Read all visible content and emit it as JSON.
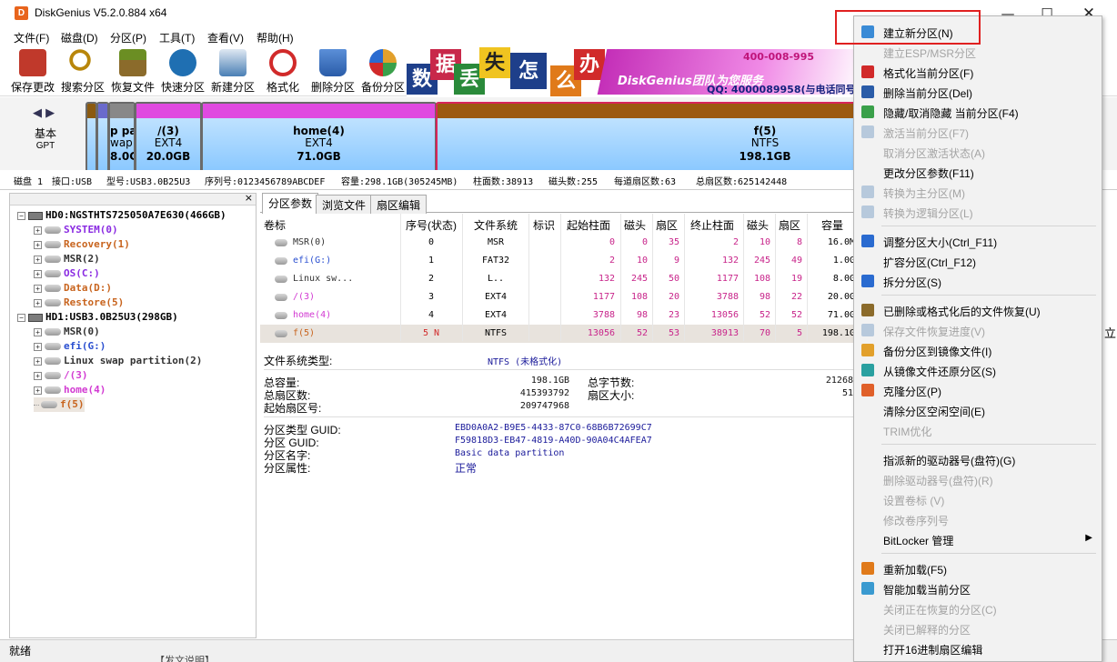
{
  "window": {
    "title": "DiskGenius V5.2.0.884 x64",
    "controls": {
      "minimize": "—",
      "maximize": "☐",
      "close": "✕"
    }
  },
  "menu": [
    "文件(F)",
    "磁盘(D)",
    "分区(P)",
    "工具(T)",
    "查看(V)",
    "帮助(H)"
  ],
  "toolbar": [
    {
      "label": "保存更改",
      "icon": "save-icon",
      "color": "#c0392b"
    },
    {
      "label": "搜索分区",
      "icon": "magnifier-icon",
      "color": "#b8860b"
    },
    {
      "label": "恢复文件",
      "icon": "recover-box-icon",
      "color": "#6b8e23"
    },
    {
      "label": "快速分区",
      "icon": "fast-partition-icon",
      "color": "#1f6fb2"
    },
    {
      "label": "新建分区",
      "icon": "new-partition-icon",
      "color": "#4a7fb5"
    },
    {
      "label": "格式化",
      "icon": "format-icon",
      "color": "#d12a2a"
    },
    {
      "label": "删除分区",
      "icon": "trash-icon",
      "color": "#2a5ca8"
    },
    {
      "label": "备份分区",
      "icon": "backup-disc-icon",
      "color": "#e2a02b"
    }
  ],
  "banner": {
    "chars": [
      "数",
      "据",
      "丢",
      "失",
      "怎",
      "么",
      "办"
    ],
    "team_text": "DiskGenius团队为您服务",
    "phone": "400-008-995",
    "qq": "QQ: 4000089958(与电话同号"
  },
  "diskmap": {
    "nav": "◀ ▶",
    "disk_type": "基本",
    "disk_style": "GPT",
    "partitions": [
      {
        "name": "",
        "fs": "",
        "size": ""
      },
      {
        "name": "",
        "fs": "",
        "size": ""
      },
      {
        "name": "p pa",
        "fs": "wap p",
        "size": "8.0GI"
      },
      {
        "name": "/(3)",
        "fs": "EXT4",
        "size": "20.0GB"
      },
      {
        "name": "home(4)",
        "fs": "EXT4",
        "size": "71.0GB"
      },
      {
        "name": "f(5)",
        "fs": "NTFS",
        "size": "198.1GB"
      }
    ]
  },
  "disk_info": {
    "disk": "磁盘 1",
    "interface": "接口:USB",
    "model": "型号:USB3.0B25U3",
    "serial": "序列号:0123456789ABCDEF",
    "capacity": "容量:298.1GB(305245MB)",
    "cylinders": "柱面数:38913",
    "heads": "磁头数:255",
    "sectors_per_track": "每道扇区数:63",
    "total_sectors": "总扇区数:625142448"
  },
  "tree": [
    {
      "text": "HD0:NGSTHTS725050A7E630(466GB)",
      "level": 0,
      "kind": "disk",
      "color": "#000000",
      "exp": "−"
    },
    {
      "text": "SYSTEM(0)",
      "level": 1,
      "kind": "part",
      "color": "#8a2be2",
      "exp": "+"
    },
    {
      "text": "Recovery(1)",
      "level": 1,
      "kind": "part",
      "color": "#c8641e",
      "exp": "+"
    },
    {
      "text": "MSR(2)",
      "level": 1,
      "kind": "part",
      "color": "#333333",
      "exp": "+"
    },
    {
      "text": "OS(C:)",
      "level": 1,
      "kind": "part",
      "color": "#8a2be2",
      "exp": "+"
    },
    {
      "text": "Data(D:)",
      "level": 1,
      "kind": "part",
      "color": "#c8641e",
      "exp": "+"
    },
    {
      "text": "Restore(5)",
      "level": 1,
      "kind": "part",
      "color": "#c8641e",
      "exp": "+"
    },
    {
      "text": "HD1:USB3.0B25U3(298GB)",
      "level": 0,
      "kind": "disk",
      "color": "#000000",
      "exp": "−"
    },
    {
      "text": "MSR(0)",
      "level": 1,
      "kind": "part",
      "color": "#333333",
      "exp": "+"
    },
    {
      "text": "efi(G:)",
      "level": 1,
      "kind": "part",
      "color": "#2a4fd0",
      "exp": "+"
    },
    {
      "text": "Linux swap partition(2)",
      "level": 1,
      "kind": "part",
      "color": "#333333",
      "exp": "+"
    },
    {
      "text": "/(3)",
      "level": 1,
      "kind": "part",
      "color": "#d23ad2",
      "exp": "+"
    },
    {
      "text": "home(4)",
      "level": 1,
      "kind": "part",
      "color": "#d23ad2",
      "exp": "+"
    },
    {
      "text": "f(5)",
      "level": 1,
      "kind": "part",
      "color": "#c8641e",
      "exp": "",
      "selected": true
    }
  ],
  "tabs": [
    "分区参数",
    "浏览文件",
    "扇区编辑"
  ],
  "table": {
    "headers": [
      "卷标",
      "序号(状态)",
      "文件系统",
      "标识",
      "起始柱面",
      "磁头",
      "扇区",
      "终止柱面",
      "磁头",
      "扇区",
      "容量"
    ],
    "rows": [
      {
        "label": "MSR(0)",
        "idx": "0",
        "fs": "MSR",
        "flag": "",
        "sc": "0",
        "sh": "0",
        "ss": "35",
        "ec": "2",
        "eh": "10",
        "es": "8",
        "size": "16.0M",
        "color": "#333333"
      },
      {
        "label": "efi(G:)",
        "idx": "1",
        "fs": "FAT32",
        "flag": "",
        "sc": "2",
        "sh": "10",
        "ss": "9",
        "ec": "132",
        "eh": "245",
        "es": "49",
        "size": "1.0G",
        "color": "#2a4fd0"
      },
      {
        "label": "Linux sw...",
        "idx": "2",
        "fs": "L..",
        "flag": "",
        "sc": "132",
        "sh": "245",
        "ss": "50",
        "ec": "1177",
        "eh": "108",
        "es": "19",
        "size": "8.0G",
        "color": "#333333"
      },
      {
        "label": "/(3)",
        "idx": "3",
        "fs": "EXT4",
        "flag": "",
        "sc": "1177",
        "sh": "108",
        "ss": "20",
        "ec": "3788",
        "eh": "98",
        "es": "22",
        "size": "20.0G",
        "color": "#d23ad2"
      },
      {
        "label": "home(4)",
        "idx": "4",
        "fs": "EXT4",
        "flag": "",
        "sc": "3788",
        "sh": "98",
        "ss": "23",
        "ec": "13056",
        "eh": "52",
        "es": "52",
        "size": "71.0G",
        "color": "#d23ad2"
      },
      {
        "label": "f(5)",
        "idx": "5 N",
        "fs": "NTFS",
        "flag": "",
        "sc": "13056",
        "sh": "52",
        "ss": "53",
        "ec": "38913",
        "eh": "70",
        "es": "5",
        "size": "198.1G",
        "color": "#c8641e",
        "selected": true
      }
    ]
  },
  "details": {
    "fs_type_label": "文件系统类型:",
    "fs_type_value": "NTFS (未格式化)",
    "total_cap_label": "总容量:",
    "total_cap_value": "198.1GB",
    "total_bytes_label": "总字节数:",
    "total_bytes_value": "21268",
    "total_sectors_label": "总扇区数:",
    "total_sectors_value": "415393792",
    "sector_size_label": "扇区大小:",
    "sector_size_value": "51",
    "start_sector_label": "起始扇区号:",
    "start_sector_value": "209747968",
    "type_guid_label": "分区类型 GUID:",
    "type_guid_value": "EBD0A0A2-B9E5-4433-87C0-68B6B72699C7",
    "part_guid_label": "分区 GUID:",
    "part_guid_value": "F59818D3-EB47-4819-A40D-90A04C4AFEA7",
    "part_name_label": "分区名字:",
    "part_name_value": "Basic data partition",
    "part_attr_label": "分区属性:",
    "part_attr_value": "正常"
  },
  "context_menu": [
    {
      "label": "建立新分区(N)",
      "enabled": true,
      "icon": "new-partition-icon",
      "color": "#3b8bd6"
    },
    {
      "label": "建立ESP/MSR分区",
      "enabled": false,
      "icon": "",
      "color": ""
    },
    {
      "label": "格式化当前分区(F)",
      "enabled": true,
      "icon": "format-icon",
      "color": "#d12a2a"
    },
    {
      "label": "删除当前分区(Del)",
      "enabled": true,
      "icon": "trash-icon",
      "color": "#2a5ca8"
    },
    {
      "label": "隐藏/取消隐藏 当前分区(F4)",
      "enabled": true,
      "icon": "hide-icon",
      "color": "#3aa04a"
    },
    {
      "label": "激活当前分区(F7)",
      "enabled": false,
      "icon": "activate-icon",
      "color": "#4a7fb5"
    },
    {
      "label": "取消分区激活状态(A)",
      "enabled": false,
      "icon": "",
      "color": ""
    },
    {
      "label": "更改分区参数(F11)",
      "enabled": true,
      "icon": "",
      "color": ""
    },
    {
      "label": "转换为主分区(M)",
      "enabled": false,
      "icon": "convert-primary-icon",
      "color": "#4a7fb5"
    },
    {
      "label": "转换为逻辑分区(L)",
      "enabled": false,
      "icon": "convert-logical-icon",
      "color": "#4a7fb5"
    },
    {
      "sep": true
    },
    {
      "label": "调整分区大小(Ctrl_F11)",
      "enabled": true,
      "icon": "resize-icon",
      "color": "#2a6bd0"
    },
    {
      "label": "扩容分区(Ctrl_F12)",
      "enabled": true,
      "icon": "",
      "color": ""
    },
    {
      "label": "拆分分区(S)",
      "enabled": true,
      "icon": "split-icon",
      "color": "#2a6bd0"
    },
    {
      "sep": true
    },
    {
      "label": "已删除或格式化后的文件恢复(U)",
      "enabled": true,
      "icon": "recover-box-icon",
      "color": "#8b6b2b"
    },
    {
      "label": "保存文件恢复进度(V)",
      "enabled": false,
      "icon": "save-progress-icon",
      "color": "#4a7fb5"
    },
    {
      "label": "备份分区到镜像文件(I)",
      "enabled": true,
      "icon": "backup-disc-icon",
      "color": "#e2a02b"
    },
    {
      "label": "从镜像文件还原分区(S)",
      "enabled": true,
      "icon": "restore-icon",
      "color": "#2aa0a0"
    },
    {
      "label": "克隆分区(P)",
      "enabled": true,
      "icon": "clone-icon",
      "color": "#e0602a"
    },
    {
      "label": "清除分区空闲空间(E)",
      "enabled": true,
      "icon": "",
      "color": ""
    },
    {
      "label": "TRIM优化",
      "enabled": false,
      "icon": "",
      "color": ""
    },
    {
      "sep": true
    },
    {
      "label": "指派新的驱动器号(盘符)(G)",
      "enabled": true,
      "icon": "",
      "color": ""
    },
    {
      "label": "删除驱动器号(盘符)(R)",
      "enabled": false,
      "icon": "",
      "color": ""
    },
    {
      "label": "设置卷标 (V)",
      "enabled": false,
      "icon": "",
      "color": ""
    },
    {
      "label": "修改卷序列号",
      "enabled": false,
      "icon": "",
      "color": ""
    },
    {
      "label": "BitLocker 管理",
      "enabled": true,
      "icon": "",
      "color": "",
      "submenu": true
    },
    {
      "sep": true
    },
    {
      "label": "重新加载(F5)",
      "enabled": true,
      "icon": "reload-icon",
      "color": "#e07a1a"
    },
    {
      "label": "智能加载当前分区",
      "enabled": true,
      "icon": "smart-load-icon",
      "color": "#3a9ad0"
    },
    {
      "label": "关闭正在恢复的分区(C)",
      "enabled": false,
      "icon": "",
      "color": ""
    },
    {
      "label": "关闭已解释的分区",
      "enabled": false,
      "icon": "",
      "color": ""
    },
    {
      "label": "打开16进制扇区编辑",
      "enabled": true,
      "icon": "",
      "color": ""
    }
  ],
  "status": "就绪",
  "bottom_fragment": "【发文说明】",
  "side_fragment": "立"
}
